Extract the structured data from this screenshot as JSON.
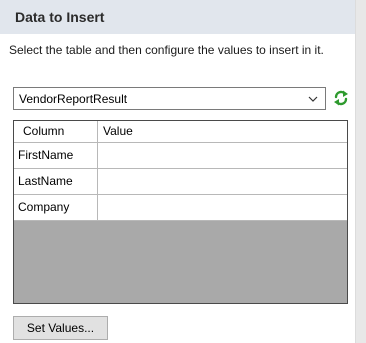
{
  "header": {
    "title": "Data to Insert"
  },
  "description": "Select the table and then configure the values to insert in it.",
  "table_select": {
    "selected": "VendorReportResult"
  },
  "grid": {
    "columns": [
      "Column",
      "Value"
    ],
    "rows": [
      {
        "column": "FirstName",
        "value": ""
      },
      {
        "column": "LastName",
        "value": ""
      },
      {
        "column": "Company",
        "value": ""
      }
    ]
  },
  "buttons": {
    "set_values": "Set Values..."
  },
  "icons": {
    "dropdown": "chevron-down-icon",
    "refresh": "refresh-icon",
    "refresh_color": "#2e9a2e"
  },
  "colors": {
    "header_bg": "#e1e6ed",
    "grid_empty_bg": "#a9a9a9"
  }
}
